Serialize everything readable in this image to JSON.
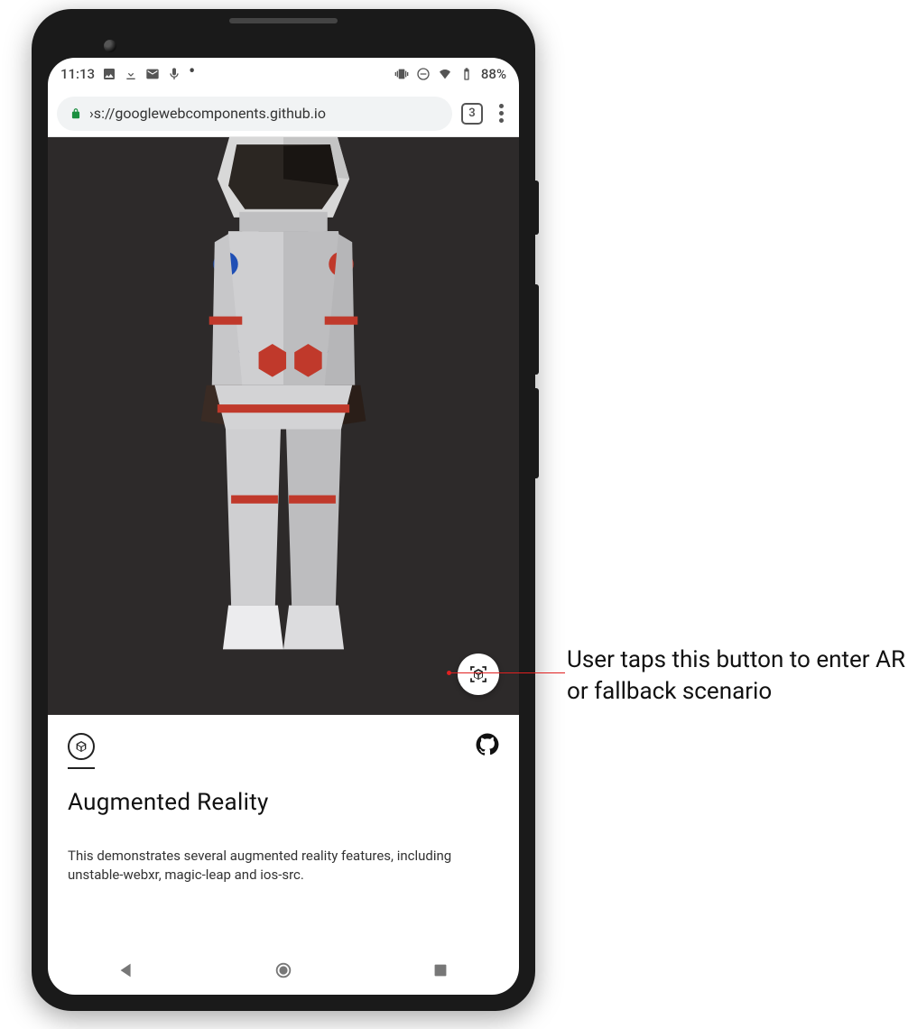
{
  "statusbar": {
    "time": "11:13",
    "battery": "88%",
    "icons": {
      "image": "image-icon",
      "download": "download-icon",
      "mail": "mail-icon",
      "mic": "mic-icon",
      "vibrate": "vibrate-icon",
      "dnd": "dnd-icon",
      "wifi": "wifi-icon",
      "battery": "battery-icon"
    }
  },
  "browser": {
    "url_display": "›s://googlewebcomponents.github.io",
    "tab_count": "3",
    "secure": true
  },
  "viewer": {
    "model_name": "astronaut-model",
    "ar_button_label": "Enter AR"
  },
  "card": {
    "title": "Augmented Reality",
    "body": "This demonstrates several augmented reality features, including unstable-webxr, magic-leap and ios-src.",
    "logo_icon": "modelviewer-logo-icon",
    "github_icon": "github-icon"
  },
  "annotation": {
    "text": "User taps this button to enter AR or fallback scenario"
  },
  "colors": {
    "viewer_bg": "#2d2a2a",
    "accent_green": "#1a8f3f",
    "leader_red": "#e02020"
  }
}
